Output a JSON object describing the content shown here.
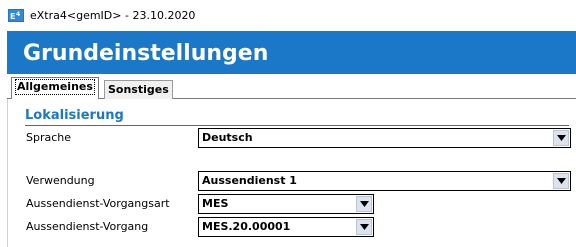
{
  "window": {
    "app_icon": "extra4-app-icon",
    "title": "eXtra4<gemID>  -  23.10.2020"
  },
  "header": {
    "title": "Grundeinstellungen",
    "background_color": "#1b77c7"
  },
  "tabs": [
    {
      "label": "Allgemeines",
      "active": true
    },
    {
      "label": "Sonstiges",
      "active": false
    }
  ],
  "section": {
    "title": "Lokalisierung",
    "accent_color": "#1b77c7"
  },
  "fields": {
    "sprache": {
      "label": "Sprache",
      "value": "Deutsch"
    },
    "verwendung": {
      "label": "Verwendung",
      "value": "Aussendienst 1"
    },
    "vorgangsart": {
      "label": "Aussendienst-Vorgangsart",
      "value": "MES"
    },
    "vorgang": {
      "label": "Aussendienst-Vorgang",
      "value": "MES.20.00001"
    }
  },
  "icons": {
    "dropdown": "chevron-down-icon"
  }
}
